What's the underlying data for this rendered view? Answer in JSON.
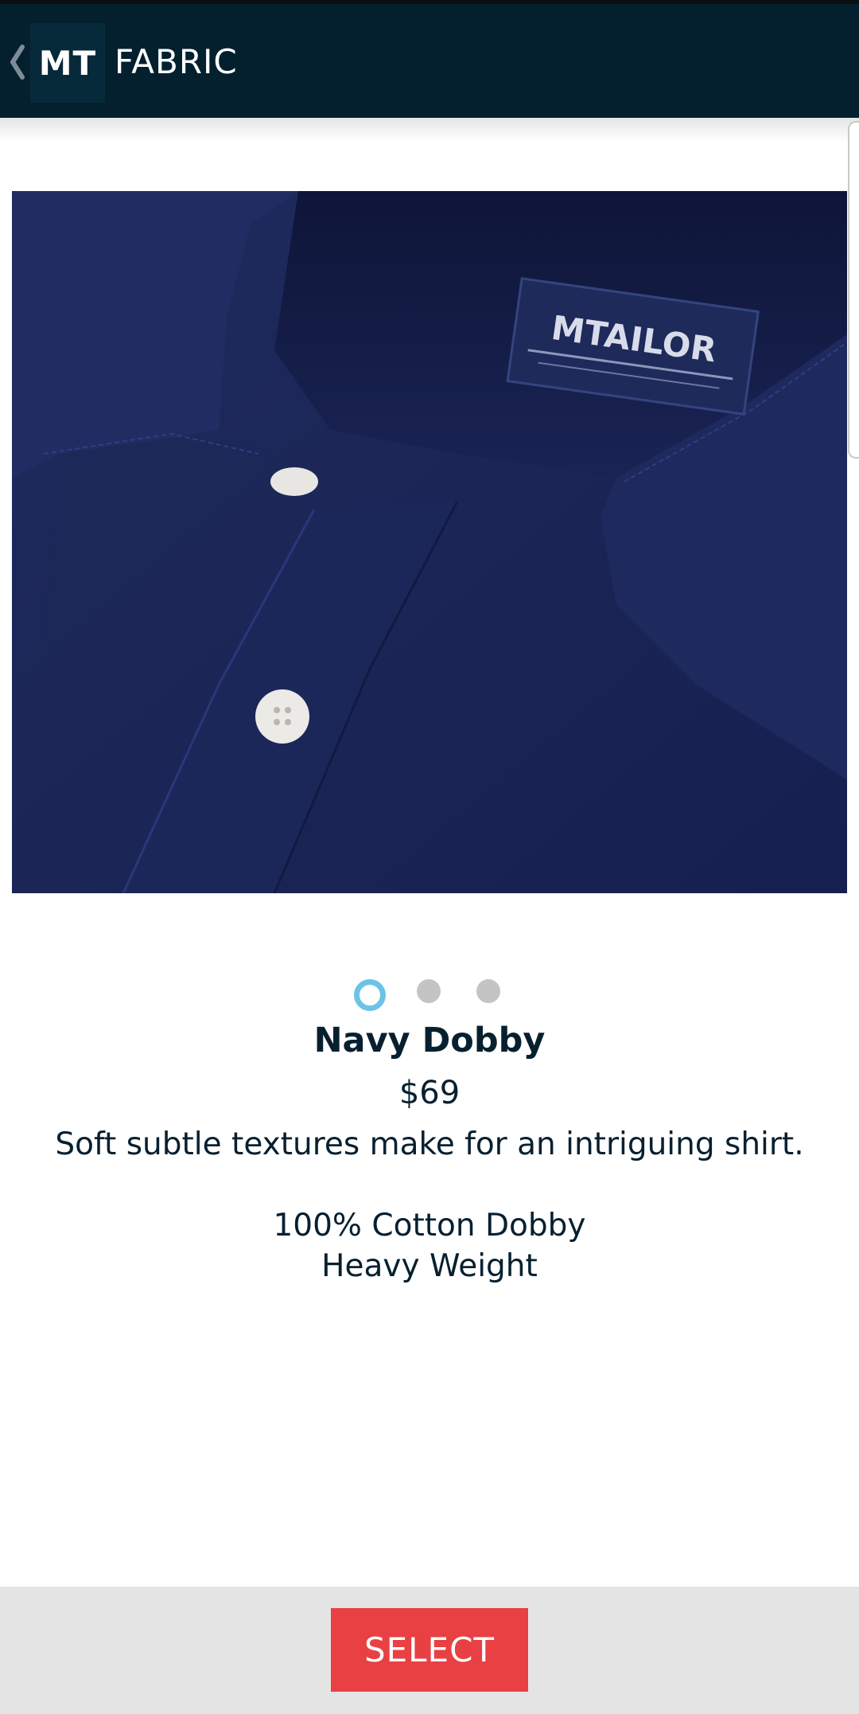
{
  "header": {
    "back_icon": "chevron-left-icon",
    "logo_text": "MT",
    "title": "FABRIC"
  },
  "product": {
    "image_alt": "Navy shirt collar close-up",
    "label_brand": "MTAILOR",
    "name": "Navy Dobby",
    "price": "$69",
    "description": "Soft subtle textures make for an intriguing shirt.",
    "specs": [
      "100% Cotton Dobby",
      "Heavy Weight"
    ]
  },
  "carousel": {
    "count": 3,
    "active_index": 0
  },
  "actions": {
    "select_label": "SELECT"
  },
  "colors": {
    "app_bar": "#04202f",
    "accent_dot": "#6cc3e6",
    "select_button": "#e84043",
    "text": "#072030",
    "shirt": "#1e2a5c"
  }
}
